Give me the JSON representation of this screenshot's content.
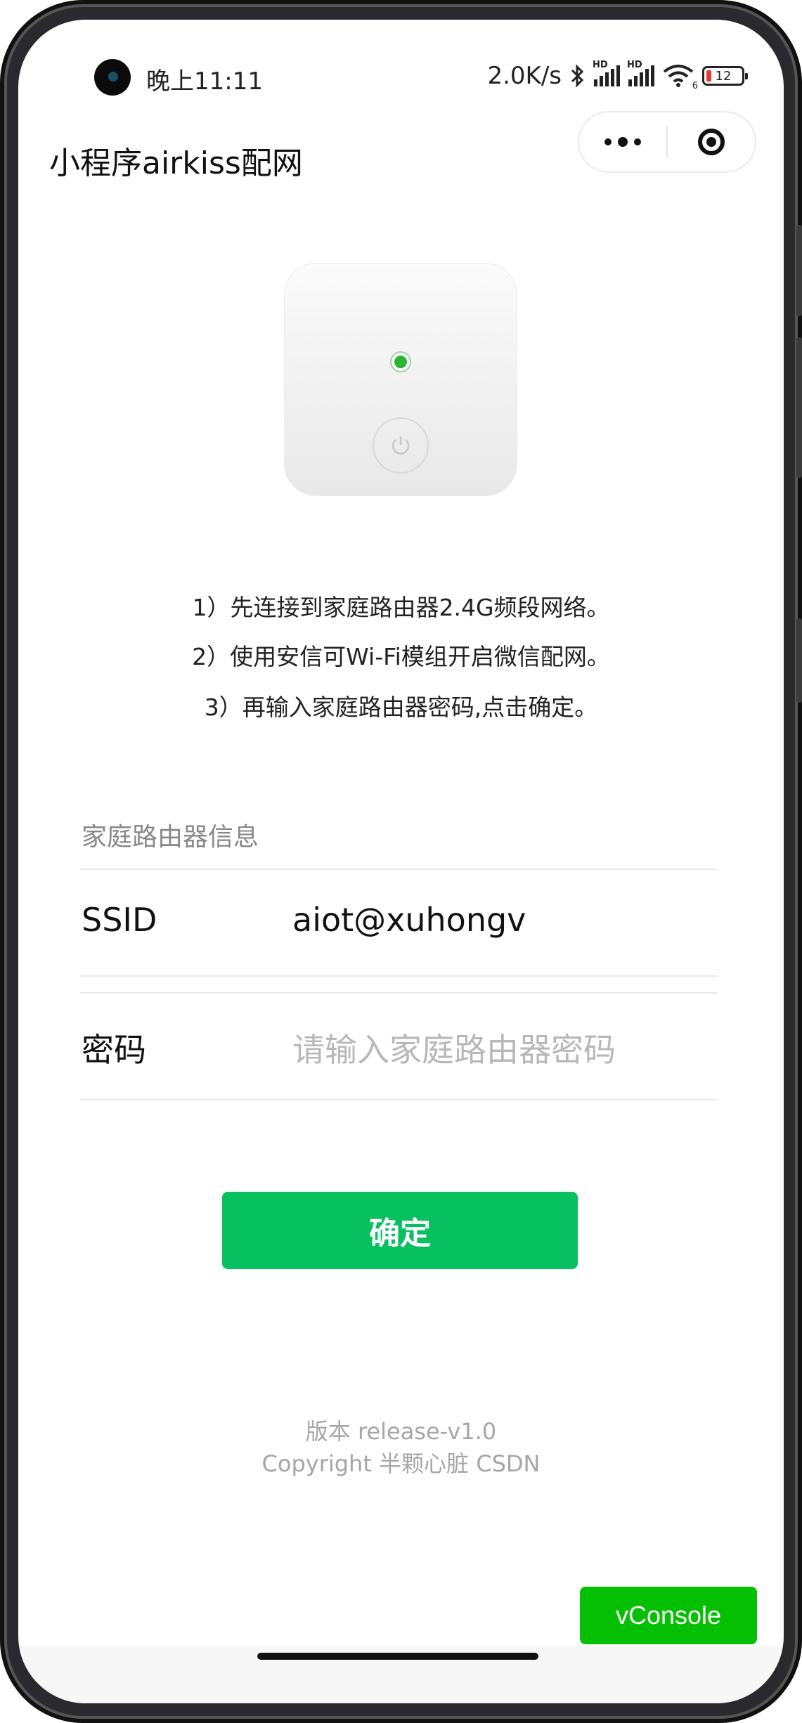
{
  "status_bar": {
    "time": "晚上11:11",
    "network_speed": "2.0K/s",
    "signal_badge": "HD",
    "wifi_level": "6",
    "battery": "12",
    "battery_color": "#e53935"
  },
  "nav": {
    "title": "小程序airkiss配网",
    "more_icon": "more-dots-icon",
    "close_icon": "target-circle-icon"
  },
  "device": {
    "led_color": "#2bb534",
    "power_icon": "power-icon"
  },
  "instructions": {
    "step1": "1）先连接到家庭路由器2.4G频段网络。",
    "step2": "2）使用安信可Wi-Fi模组开启微信配网。",
    "step3": "3）再输入家庭路由器密码,点击确定。"
  },
  "form": {
    "section_title": "家庭路由器信息",
    "ssid_label": "SSID",
    "ssid_value": "aiot@xuhongv",
    "password_label": "密码",
    "password_value": "",
    "password_placeholder": "请输入家庭路由器密码"
  },
  "confirm_button": {
    "label": "确定",
    "color": "#07c160"
  },
  "footer": {
    "version": "版本 release-v1.0",
    "copyright": "Copyright 半颗心脏 CSDN"
  },
  "vconsole": {
    "label": "vConsole",
    "color": "#05c002"
  }
}
